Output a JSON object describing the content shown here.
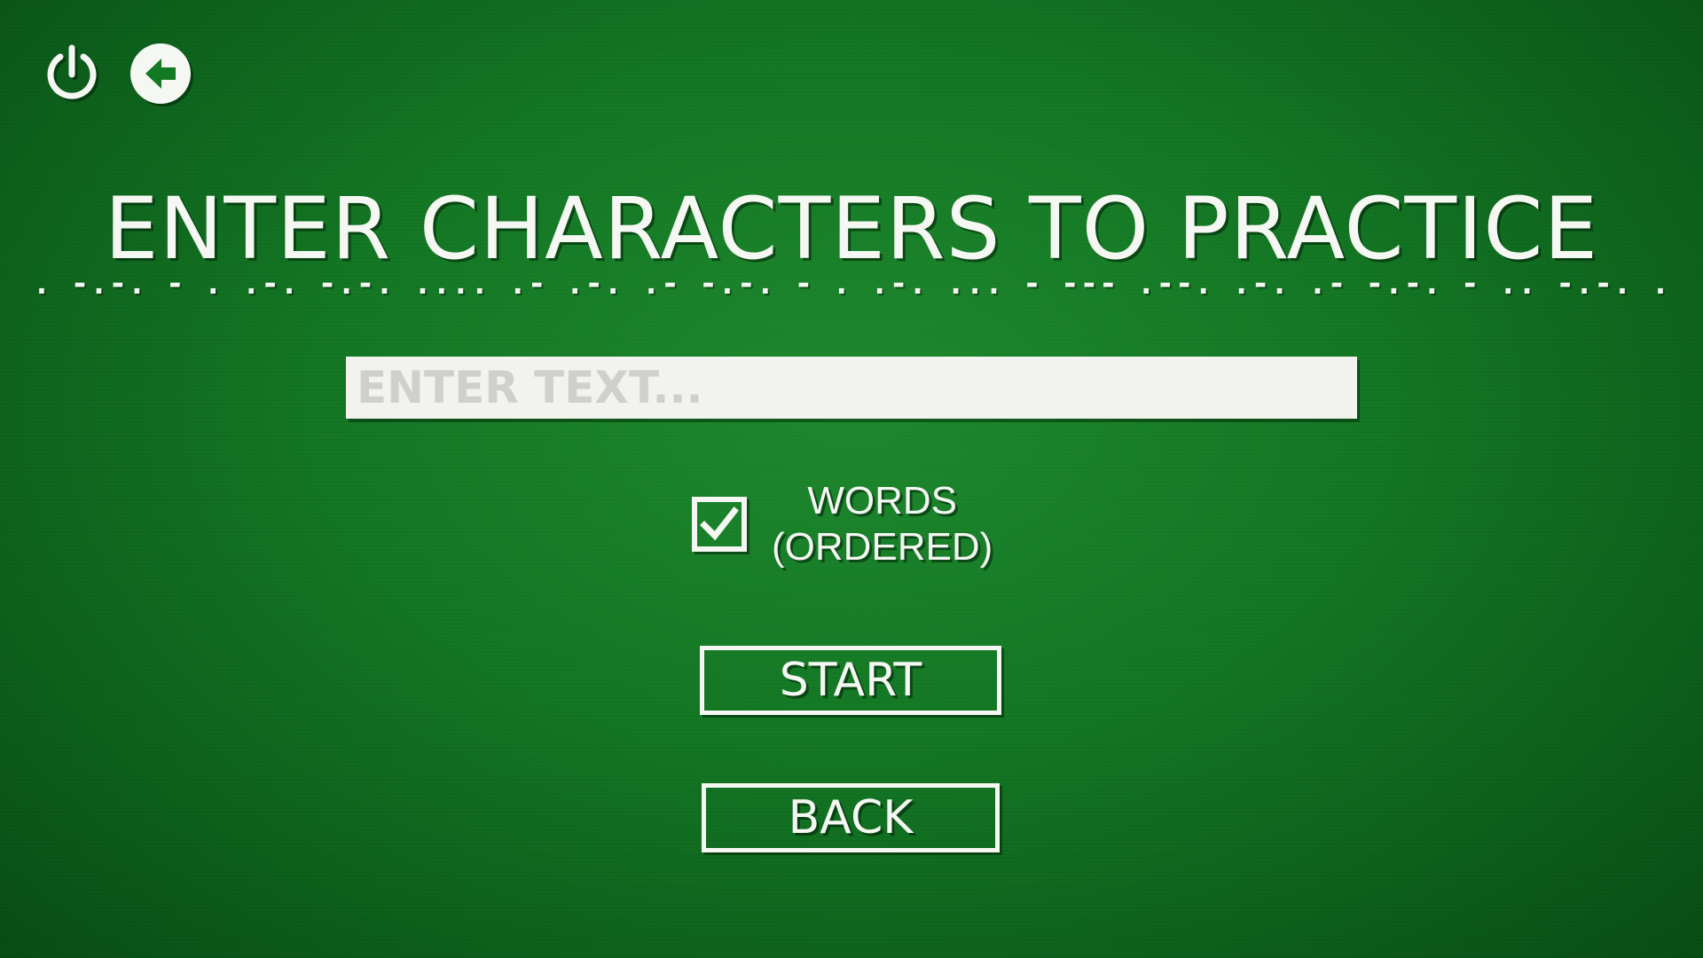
{
  "toolbar": {
    "power_icon": "power-icon",
    "back_icon": "back-arrow-icon"
  },
  "title": "ENTER CHARACTERS TO PRACTICE",
  "title_morse": ". -.-. - . .-. -.-. .... .- .-. .- -.-. - . .-. ... - --- .--. .-. .- -.-. - .. -.-. .",
  "input": {
    "value": "",
    "placeholder": "ENTER TEXT..."
  },
  "words_option": {
    "checked": true,
    "label_line1": "WORDS",
    "label_line2": "(ORDERED)"
  },
  "buttons": {
    "start": "START",
    "back": "BACK"
  },
  "colors": {
    "background": "#137a24",
    "foreground": "#f4f7f2",
    "input_background": "#f2f2ef",
    "placeholder": "#cfcfcb"
  }
}
